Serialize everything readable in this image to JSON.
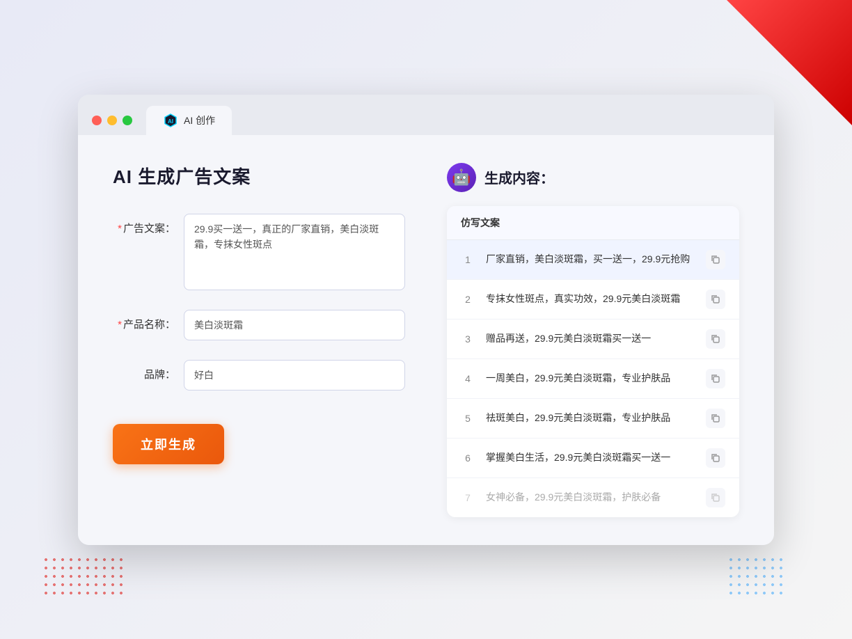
{
  "browser": {
    "tab_label": "AI 创作"
  },
  "page": {
    "title": "AI 生成广告文案",
    "generate_button": "立即生成"
  },
  "form": {
    "ad_copy_label": "广告文案：",
    "ad_copy_required": "＊",
    "ad_copy_value": "29.9买一送一，真正的厂家直销，美白淡斑霜，专抹女性斑点",
    "product_name_label": "产品名称：",
    "product_name_required": "＊",
    "product_name_value": "美白淡斑霜",
    "brand_label": "品牌：",
    "brand_value": "好白"
  },
  "results": {
    "section_title": "生成内容：",
    "table_header": "仿写文案",
    "items": [
      {
        "num": "1",
        "text": "厂家直销，美白淡斑霜，买一送一，29.9元抢购",
        "muted": false
      },
      {
        "num": "2",
        "text": "专抹女性斑点，真实功效，29.9元美白淡斑霜",
        "muted": false
      },
      {
        "num": "3",
        "text": "赠品再送，29.9元美白淡斑霜买一送一",
        "muted": false
      },
      {
        "num": "4",
        "text": "一周美白，29.9元美白淡斑霜，专业护肤品",
        "muted": false
      },
      {
        "num": "5",
        "text": "祛斑美白，29.9元美白淡斑霜，专业护肤品",
        "muted": false
      },
      {
        "num": "6",
        "text": "掌握美白生活，29.9元美白淡斑霜买一送一",
        "muted": false
      },
      {
        "num": "7",
        "text": "女神必备，29.9元美白淡斑霜，护肤必备",
        "muted": true
      }
    ]
  }
}
